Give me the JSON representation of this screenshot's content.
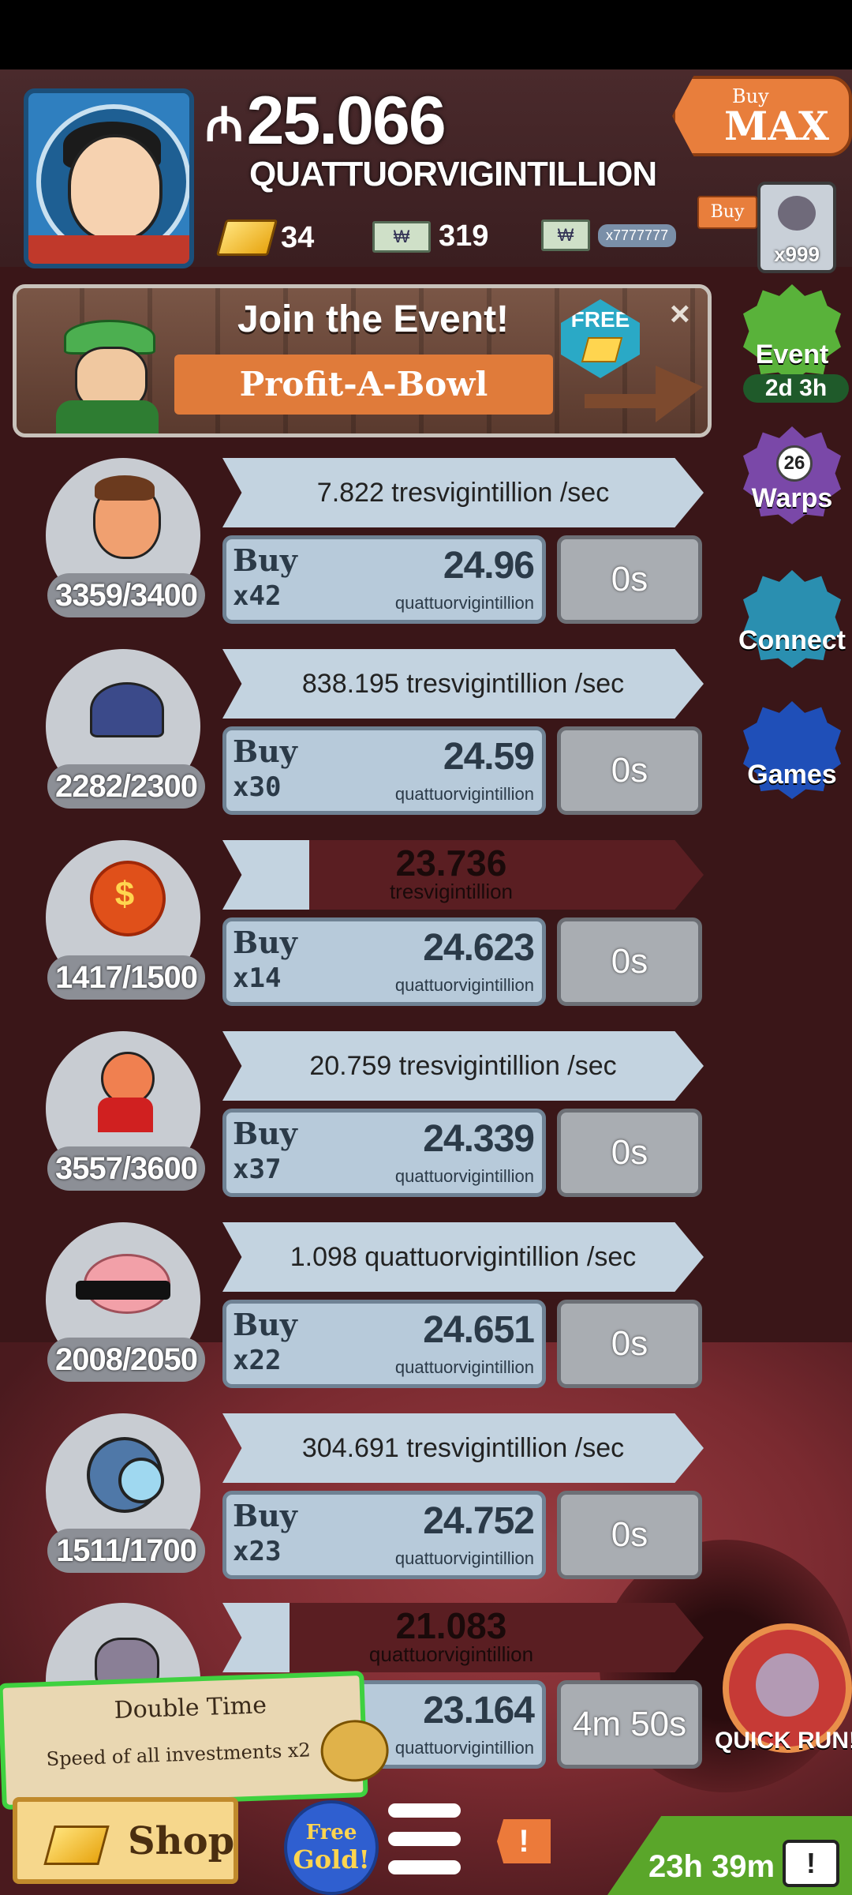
{
  "header": {
    "money_symbol": "₼",
    "money_value": "25.066",
    "money_unit": "QUATTUORVIGINTILLION",
    "gold_count": "34",
    "megabucks_count": "319",
    "multiplier_label": "x7777777",
    "buy_max_small": "Buy",
    "buy_max_big": "MAX",
    "buy_mini_label": "Buy",
    "spider_badge": "x999"
  },
  "event": {
    "title": "Join the Event!",
    "subtitle": "Profit-A-Bowl",
    "free_label": "FREE",
    "close_label": "×"
  },
  "side": {
    "event_label": "Event",
    "event_time": "2d 3h",
    "warps_count": "26",
    "warps_label": "Warps",
    "connect_label": "Connect",
    "games_label": "Games"
  },
  "businesses": [
    {
      "count": "3359/3400",
      "rate": "7.822 tresvigintillion /sec",
      "buy_label": "Buy",
      "buy_qty": "x42",
      "cost": "24.96",
      "cost_unit": "quattuorvigintillion",
      "time": "0s"
    },
    {
      "count": "2282/2300",
      "rate": "838.195 tresvigintillion /sec",
      "buy_label": "Buy",
      "buy_qty": "x30",
      "cost": "24.59",
      "cost_unit": "quattuorvigintillion",
      "time": "0s"
    },
    {
      "count": "1417/1500",
      "rate_value": "23.736",
      "rate_unit": "tresvigintillion",
      "progress": 0.18,
      "buy_label": "Buy",
      "buy_qty": "x14",
      "cost": "24.623",
      "cost_unit": "quattuorvigintillion",
      "time": "0s"
    },
    {
      "count": "3557/3600",
      "rate": "20.759 tresvigintillion /sec",
      "buy_label": "Buy",
      "buy_qty": "x37",
      "cost": "24.339",
      "cost_unit": "quattuorvigintillion",
      "time": "0s"
    },
    {
      "count": "2008/2050",
      "rate": "1.098 quattuorvigintillion /sec",
      "buy_label": "Buy",
      "buy_qty": "x22",
      "cost": "24.651",
      "cost_unit": "quattuorvigintillion",
      "time": "0s"
    },
    {
      "count": "1511/1700",
      "rate": "304.691 tresvigintillion /sec",
      "buy_label": "Buy",
      "buy_qty": "x23",
      "cost": "24.752",
      "cost_unit": "quattuorvigintillion",
      "time": "0s"
    },
    {
      "rate_value": "21.083",
      "rate_unit": "quattuorvigintillion",
      "progress": 0.14,
      "cost": "23.164",
      "cost_unit": "quattuorvigintillion",
      "time": "4m 50s"
    }
  ],
  "double_time": {
    "title": "Double Time",
    "desc": "Speed of all investments x2"
  },
  "quick_run": "QUICK RUN!",
  "bottom": {
    "shop": "Shop",
    "free_gold_1": "Free",
    "free_gold_2": "Gold!",
    "alert": "!",
    "timer": "23h 39m",
    "tv_icon": "!"
  },
  "colors": {
    "background": "#3a1618",
    "accent_orange": "#e87e3c",
    "panel_blue": "#c3d3e0",
    "highlight_green": "#3fd13f"
  }
}
